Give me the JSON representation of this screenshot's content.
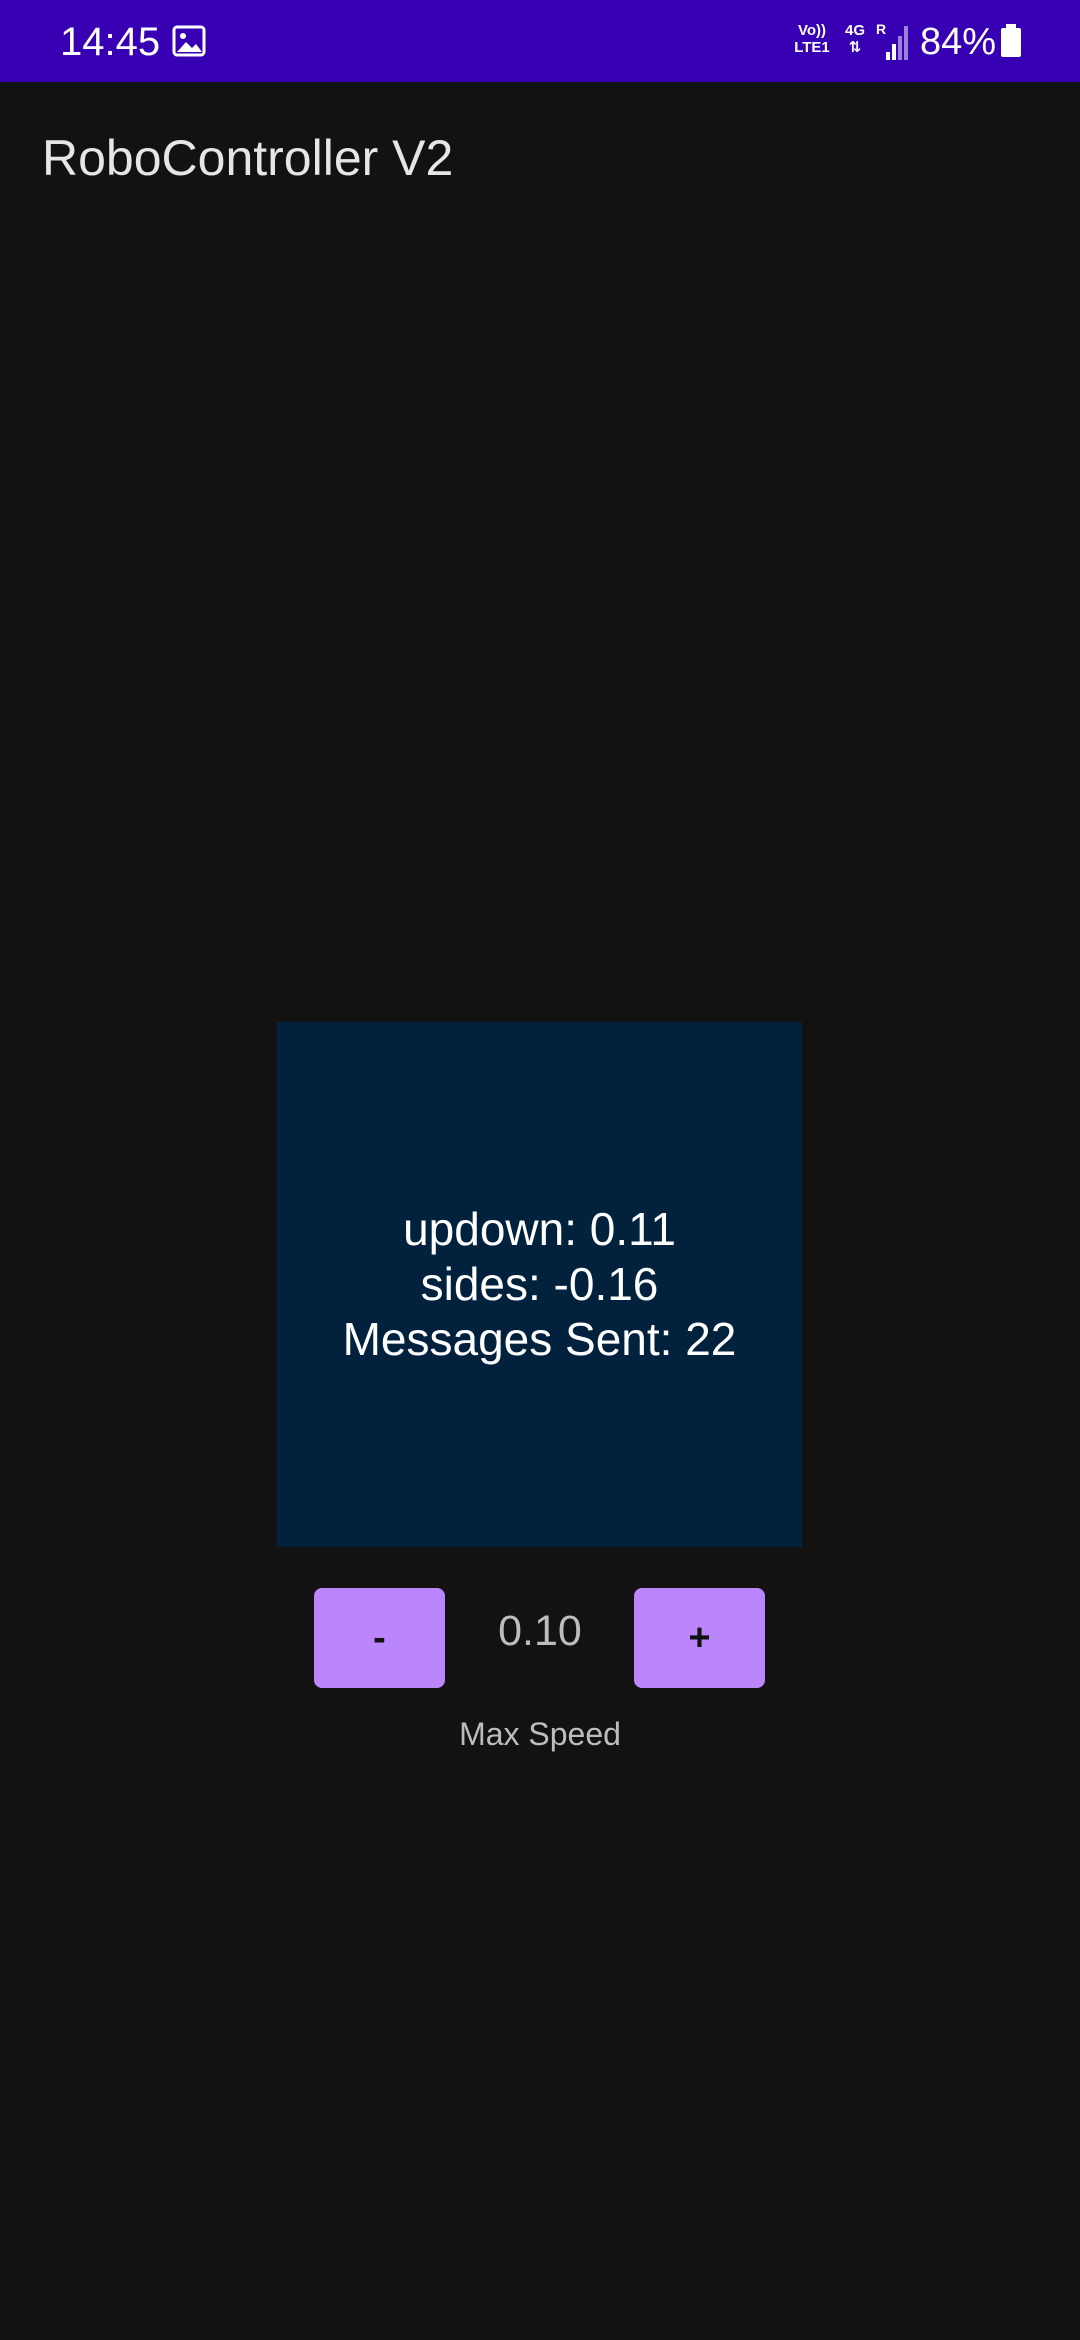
{
  "status_bar": {
    "time": "14:45",
    "volte_line1": "Vo))",
    "volte_line2": "LTE1",
    "network_type": "4G",
    "roaming": "R",
    "battery_percent": "84%",
    "background_color": "#3700b3"
  },
  "app": {
    "title": "RoboController V2"
  },
  "joystick": {
    "updown_text": "updown: 0.11",
    "sides_text": "sides: -0.16",
    "messages_text": "Messages Sent: 22",
    "background_color": "#01213d"
  },
  "speed_control": {
    "decrease_label": "-",
    "increase_label": "+",
    "value": "0.10",
    "label": "Max Speed",
    "button_color": "#bb86fc"
  }
}
